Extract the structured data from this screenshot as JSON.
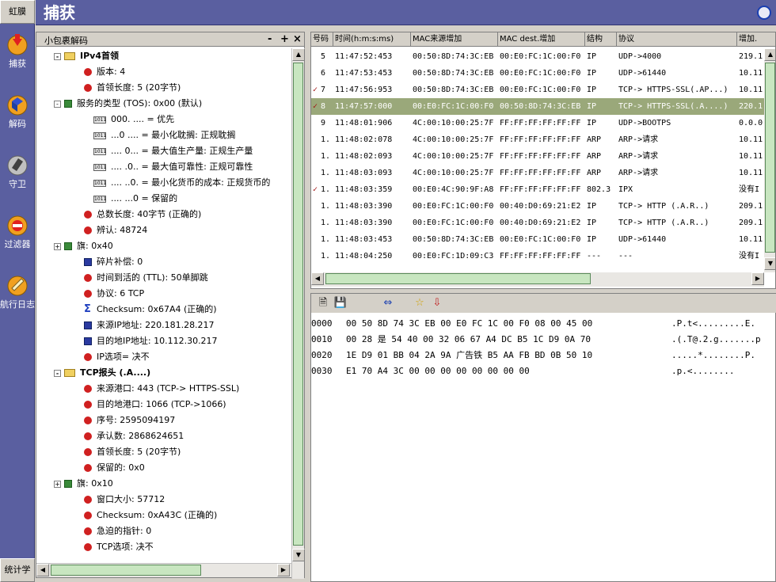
{
  "sidebar": {
    "top_label": "虹膜",
    "bottom_label": "统计学",
    "items": [
      {
        "label": "捕获",
        "icon": "capture-icon"
      },
      {
        "label": "解码",
        "icon": "decode-icon"
      },
      {
        "label": "守卫",
        "icon": "guard-icon"
      },
      {
        "label": "过滤器",
        "icon": "filter-icon"
      },
      {
        "label": "航行日志",
        "icon": "log-icon"
      }
    ]
  },
  "titlebar": {
    "title": "捕获"
  },
  "decoder": {
    "title": "小包裹解码",
    "minus": "-",
    "plus": "+",
    "close": "×",
    "tree": [
      {
        "depth": 1,
        "expander": "-",
        "icon": "folder",
        "text": "IPv4首领",
        "bold": true
      },
      {
        "depth": 2,
        "expander": "",
        "icon": "dot",
        "text": "版本: 4"
      },
      {
        "depth": 2,
        "expander": "",
        "icon": "dot",
        "text": "首领长度: 5 (20字节)"
      },
      {
        "depth": 1,
        "expander": "-",
        "icon": "flag",
        "text": "服务的类型 (TOS): 0x00 (默认)"
      },
      {
        "depth": 3,
        "expander": "",
        "icon": "bin",
        "text": "000. .... = 优先"
      },
      {
        "depth": 3,
        "expander": "",
        "icon": "bin",
        "text": "...0 .... = 最小化耽搁: 正规耽搁"
      },
      {
        "depth": 3,
        "expander": "",
        "icon": "bin",
        "text": ".... 0... = 最大值生产量: 正规生产量"
      },
      {
        "depth": 3,
        "expander": "",
        "icon": "bin",
        "text": ".... .0.. = 最大值可靠性: 正规可靠性"
      },
      {
        "depth": 3,
        "expander": "",
        "icon": "bin",
        "text": ".... ..0. = 最小化货币的成本: 正规货币的"
      },
      {
        "depth": 3,
        "expander": "",
        "icon": "bin",
        "text": ".... ...0 = 保留的"
      },
      {
        "depth": 2,
        "expander": "",
        "icon": "dot",
        "text": "总数长度: 40字节 (正确的)"
      },
      {
        "depth": 2,
        "expander": "",
        "icon": "dot",
        "text": "辨认: 48724"
      },
      {
        "depth": 1,
        "expander": "+",
        "icon": "flag",
        "text": "旗: 0x40"
      },
      {
        "depth": 2,
        "expander": "",
        "icon": "doc",
        "text": "碎片补偿: 0"
      },
      {
        "depth": 2,
        "expander": "",
        "icon": "dot",
        "text": "时间到活的 (TTL): 50单脚跳"
      },
      {
        "depth": 2,
        "expander": "",
        "icon": "dot",
        "text": "协议: 6  TCP"
      },
      {
        "depth": 2,
        "expander": "",
        "icon": "sum",
        "text": "Checksum: 0x67A4 (正确的)"
      },
      {
        "depth": 2,
        "expander": "",
        "icon": "doc",
        "text": "来源IP地址: 220.181.28.217"
      },
      {
        "depth": 2,
        "expander": "",
        "icon": "doc",
        "text": "目的地IP地址: 10.112.30.217"
      },
      {
        "depth": 2,
        "expander": "",
        "icon": "dot",
        "text": "IP选项= 决不"
      },
      {
        "depth": 1,
        "expander": "-",
        "icon": "folder",
        "text": "TCP报头 (.A....)",
        "bold": true
      },
      {
        "depth": 2,
        "expander": "",
        "icon": "dot",
        "text": "来源港口: 443 (TCP-> HTTPS-SSL)"
      },
      {
        "depth": 2,
        "expander": "",
        "icon": "dot",
        "text": "目的地港口: 1066 (TCP->1066)"
      },
      {
        "depth": 2,
        "expander": "",
        "icon": "dot",
        "text": "序号: 2595094197"
      },
      {
        "depth": 2,
        "expander": "",
        "icon": "dot",
        "text": "承认数: 2868624651"
      },
      {
        "depth": 2,
        "expander": "",
        "icon": "dot",
        "text": "首领长度: 5 (20字节)"
      },
      {
        "depth": 2,
        "expander": "",
        "icon": "dot",
        "text": "保留的: 0x0"
      },
      {
        "depth": 1,
        "expander": "+",
        "icon": "flag",
        "text": "旗: 0x10"
      },
      {
        "depth": 2,
        "expander": "",
        "icon": "dot",
        "text": "窗口大小: 57712"
      },
      {
        "depth": 2,
        "expander": "",
        "icon": "dot",
        "text": "Checksum: 0xA43C (正确的)"
      },
      {
        "depth": 2,
        "expander": "",
        "icon": "dot",
        "text": "急迫的指针: 0"
      },
      {
        "depth": 2,
        "expander": "",
        "icon": "dot",
        "text": "TCP选项: 决不"
      }
    ]
  },
  "packets": {
    "columns": [
      "号码",
      "时间(h:m:s:ms)",
      "MAC来源增加",
      "MAC dest.增加",
      "结构",
      "协议",
      "增加."
    ],
    "rows": [
      {
        "mark": "",
        "no": "5",
        "time": "11:47:52:453",
        "src": "00:50:8D:74:3C:EB",
        "dst": "00:E0:FC:1C:00:F0",
        "frame": "IP",
        "proto": "UDP->4000",
        "addr": "219.1:",
        "selected": false
      },
      {
        "mark": "",
        "no": "6",
        "time": "11:47:53:453",
        "src": "00:50:8D:74:3C:EB",
        "dst": "00:E0:FC:1C:00:F0",
        "frame": "IP",
        "proto": "UDP->61440",
        "addr": "10.11:",
        "selected": false
      },
      {
        "mark": "✓",
        "no": "7",
        "time": "11:47:56:953",
        "src": "00:50:8D:74:3C:EB",
        "dst": "00:E0:FC:1C:00:F0",
        "frame": "IP",
        "proto": "TCP-> HTTPS-SSL(.AP...)",
        "addr": "10.11:",
        "selected": false
      },
      {
        "mark": "✓",
        "no": "8",
        "time": "11:47:57:000",
        "src": "00:E0:FC:1C:00:F0",
        "dst": "00:50:8D:74:3C:EB",
        "frame": "IP",
        "proto": "TCP-> HTTPS-SSL(.A....)",
        "addr": "220.1:",
        "selected": true
      },
      {
        "mark": "",
        "no": "9",
        "time": "11:48:01:906",
        "src": "4C:00:10:00:25:7F",
        "dst": "FF:FF:FF:FF:FF:FF",
        "frame": "IP",
        "proto": "UDP->BOOTPS",
        "addr": "0.0.0",
        "selected": false
      },
      {
        "mark": "",
        "no": "1.",
        "time": "11:48:02:078",
        "src": "4C:00:10:00:25:7F",
        "dst": "FF:FF:FF:FF:FF:FF",
        "frame": "ARP",
        "proto": "ARP->请求",
        "addr": "10.11:",
        "selected": false
      },
      {
        "mark": "",
        "no": "1.",
        "time": "11:48:02:093",
        "src": "4C:00:10:00:25:7F",
        "dst": "FF:FF:FF:FF:FF:FF",
        "frame": "ARP",
        "proto": "ARP->请求",
        "addr": "10.11:",
        "selected": false
      },
      {
        "mark": "",
        "no": "1.",
        "time": "11:48:03:093",
        "src": "4C:00:10:00:25:7F",
        "dst": "FF:FF:FF:FF:FF:FF",
        "frame": "ARP",
        "proto": "ARP->请求",
        "addr": "10.11:",
        "selected": false
      },
      {
        "mark": "✓",
        "no": "1.",
        "time": "11:48:03:359",
        "src": "00:E0:4C:90:9F:A8",
        "dst": "FF:FF:FF:FF:FF:FF",
        "frame": "802.3",
        "proto": "IPX",
        "addr": "没有I",
        "selected": false
      },
      {
        "mark": "",
        "no": "1.",
        "time": "11:48:03:390",
        "src": "00:E0:FC:1C:00:F0",
        "dst": "00:40:D0:69:21:E2",
        "frame": "IP",
        "proto": "TCP-> HTTP (.A.R..)",
        "addr": "209.1:",
        "selected": false
      },
      {
        "mark": "",
        "no": "1.",
        "time": "11:48:03:390",
        "src": "00:E0:FC:1C:00:F0",
        "dst": "00:40:D0:69:21:E2",
        "frame": "IP",
        "proto": "TCP-> HTTP (.A.R..)",
        "addr": "209.1:",
        "selected": false
      },
      {
        "mark": "",
        "no": "1.",
        "time": "11:48:03:453",
        "src": "00:50:8D:74:3C:EB",
        "dst": "00:E0:FC:1C:00:F0",
        "frame": "IP",
        "proto": "UDP->61440",
        "addr": "10.11:",
        "selected": false
      },
      {
        "mark": "",
        "no": "1.",
        "time": "11:48:04:250",
        "src": "00:E0:FC:1D:09:C3",
        "dst": "FF:FF:FF:FF:FF:FF",
        "frame": "---",
        "proto": "---",
        "addr": "没有I",
        "selected": false
      }
    ]
  },
  "hex": {
    "rows": [
      {
        "offset": "0000",
        "bytes": "00 50 8D 74 3C EB 00 E0 FC 1C 00 F0 08 00 45 00",
        "ascii": ".P.t<.........E."
      },
      {
        "offset": "0010",
        "bytes": "00 28 是 54 40 00 32 06 67 A4 DC B5 1C D9 0A 70",
        "ascii": ".(.T@.2.g.......p"
      },
      {
        "offset": "0020",
        "bytes": "1E D9 01 BB 04 2A 9A 广告铁 B5 AA FB BD 0B 50 10",
        "ascii": ".....*........P."
      },
      {
        "offset": "0030",
        "bytes": "E1 70 A4 3C 00 00 00 00 00 00 00 00",
        "ascii": ".p.<........"
      }
    ]
  },
  "colors": {
    "sidebar": "#5a5fa0",
    "selected_row": "#9aa87a",
    "bullet": "#d02020",
    "check": "#a01010"
  }
}
